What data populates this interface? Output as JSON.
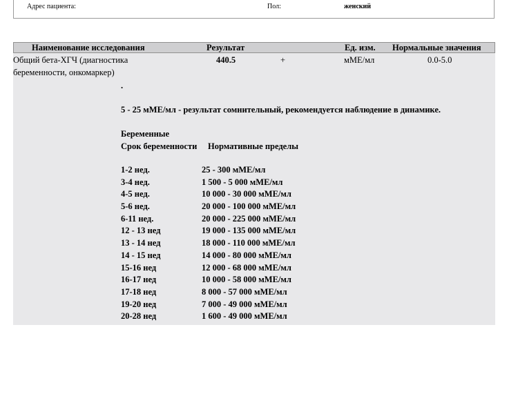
{
  "patient": {
    "address_label": "Адрес пациента:",
    "sex_label": "Пол:",
    "sex_value": "женский"
  },
  "table": {
    "headers": {
      "name": "Наименование исследования",
      "result": "Результат",
      "unit": "Ед. изм.",
      "norm": "Нормальные значения"
    },
    "row": {
      "name_line1": "Общий бета-ХГЧ (диагностика",
      "name_line2": "беременности, онкомаркер)",
      "result": "440.5",
      "flag": "+",
      "unit": "мМЕ/мл",
      "norm": "0.0-5.0"
    }
  },
  "comment": {
    "dot": ".",
    "doubtful": "5 - 25 мМЕ/мл - результат сомнительный, рекомендуется наблюдение в динамике.",
    "pregnant_title": "Беременные",
    "col_term": "Срок беременности",
    "col_limits": "Нормативные пределы",
    "ranges": [
      {
        "term": "1-2 нед.",
        "range": "25 - 300 мМЕ/мл"
      },
      {
        "term": "3-4 нед.",
        "range": "1 500 - 5 000 мМЕ/мл"
      },
      {
        "term": "4-5 нед.",
        "range": "10 000 - 30 000 мМЕ/мл"
      },
      {
        "term": "5-6 нед.",
        "range": "20 000 - 100 000 мМЕ/мл"
      },
      {
        "term": "6-11 нед.",
        "range": "20 000 - 225 000 мМЕ/мл"
      },
      {
        "term": "12 - 13 нед",
        "range": "19 000 - 135 000 мМЕ/мл"
      },
      {
        "term": "13 - 14 нед",
        "range": "18 000 - 110 000 мМЕ/мл"
      },
      {
        "term": "14 - 15 нед",
        "range": "14 000 - 80 000 мМЕ/мл"
      },
      {
        "term": "15-16 нед",
        "range": "12 000 - 68 000 мМЕ/мл"
      },
      {
        "term": "16-17 нед",
        "range": "10 000 - 58 000 мМЕ/мл"
      },
      {
        "term": "17-18 нед",
        "range": "8 000 - 57 000 мМЕ/мл"
      },
      {
        "term": "19-20 нед",
        "range": "7 000 - 49 000 мМЕ/мл"
      },
      {
        "term": "20-28 нед",
        "range": "1 600 - 49 000 мМЕ/мл"
      }
    ]
  }
}
